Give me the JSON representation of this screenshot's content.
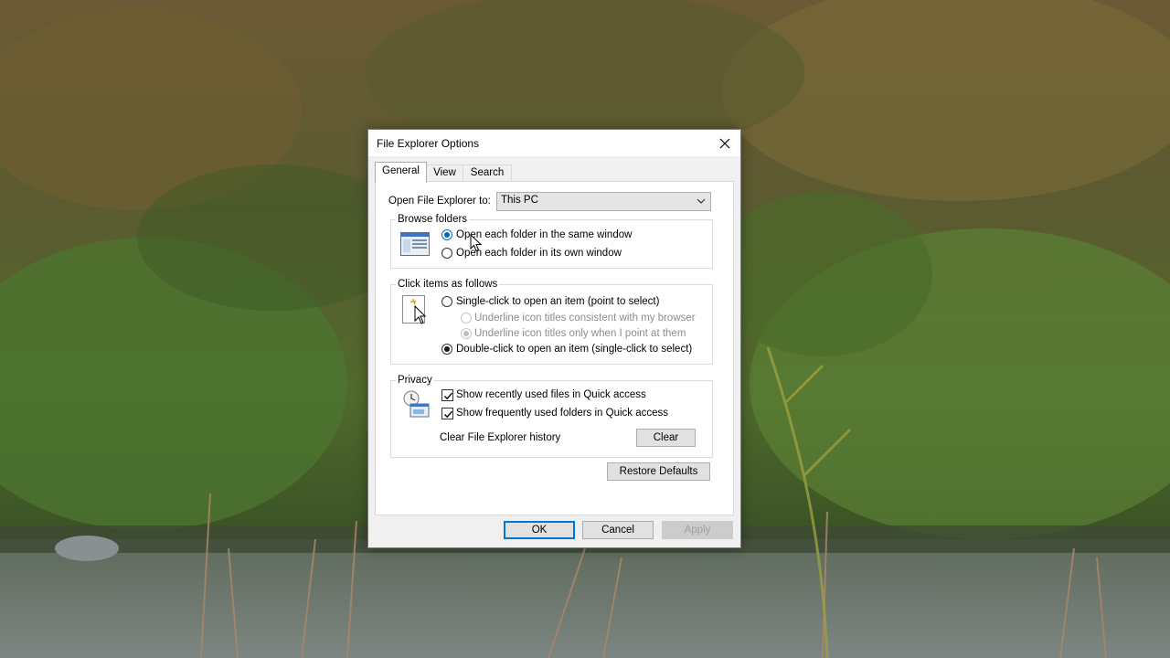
{
  "dialog": {
    "title": "File Explorer Options",
    "tabs": [
      {
        "label": "General",
        "active": true
      },
      {
        "label": "View",
        "active": false
      },
      {
        "label": "Search",
        "active": false
      }
    ]
  },
  "general": {
    "open_to_label": "Open File Explorer to:",
    "open_to_value": "This PC",
    "browse": {
      "title": "Browse folders",
      "options": [
        {
          "label": "Open each folder in the same window",
          "selected": true
        },
        {
          "label": "Open each folder in its own window",
          "selected": false
        }
      ]
    },
    "click": {
      "title": "Click items as follows",
      "single_click": {
        "label": "Single-click to open an item (point to select)",
        "selected": false
      },
      "underline_browser": {
        "label": "Underline icon titles consistent with my browser",
        "selected": false,
        "disabled": true
      },
      "underline_point": {
        "label": "Underline icon titles only when I point at them",
        "selected": true,
        "disabled": true
      },
      "double_click": {
        "label": "Double-click to open an item (single-click to select)",
        "selected": true
      }
    },
    "privacy": {
      "title": "Privacy",
      "recent_files": {
        "label": "Show recently used files in Quick access",
        "checked": true
      },
      "frequent_folders": {
        "label": "Show frequently used folders in Quick access",
        "checked": true
      },
      "clear_history_label": "Clear File Explorer history",
      "clear_button": "Clear"
    },
    "restore_defaults": "Restore Defaults"
  },
  "buttons": {
    "ok": "OK",
    "cancel": "Cancel",
    "apply": "Apply"
  },
  "icons": {
    "close": "close-icon",
    "dropdown": "chevron-down-icon",
    "browse": "window-icon",
    "click": "pointer-icon",
    "privacy": "privacy-icon"
  }
}
